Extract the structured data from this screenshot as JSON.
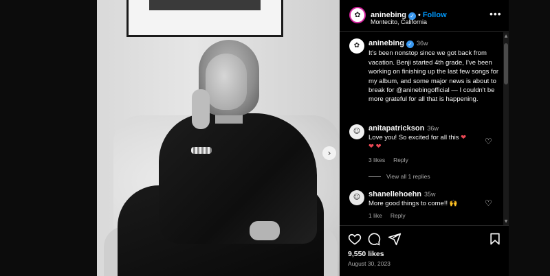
{
  "post": {
    "next_photo_glyph": "›"
  },
  "header": {
    "avatar_glyph": "✿",
    "username": "aninebing",
    "verified_glyph": "✓",
    "separator": "•",
    "follow_label": "Follow",
    "location": "Montecito, California",
    "more_glyph": "•••"
  },
  "caption": {
    "avatar_glyph": "✿",
    "username": "aninebing",
    "time": "36w",
    "text": "It's been nonstop since we got back from vacation. Benji started 4th grade, I've been working on finishing up the last few songs for my album, and some major news is about to break for @aninebingofficial — I couldn't be more grateful for all that is happening."
  },
  "comments": [
    {
      "avatar_glyph": "☺",
      "username": "anitapatrickson",
      "time": "36w",
      "text": "Love you! So excited for all this ",
      "hearts": "❤\n❤ ❤",
      "likes": "3 likes",
      "reply_label": "Reply",
      "view_replies": "View all 1 replies"
    },
    {
      "avatar_glyph": "☺",
      "username": "shanellehoehn",
      "time": "35w",
      "text": "More good things to come!! 🙌",
      "likes": "1 like",
      "reply_label": "Reply"
    }
  ],
  "actions": {
    "likes_count": "9,550 likes",
    "date": "August 30, 2023"
  },
  "scroll": {
    "up": "▲",
    "down": "▼"
  },
  "like_glyph": "♡",
  "colors": {
    "follow": "#0095f6",
    "verified": "#3897f0",
    "heart": "#ed4956"
  }
}
